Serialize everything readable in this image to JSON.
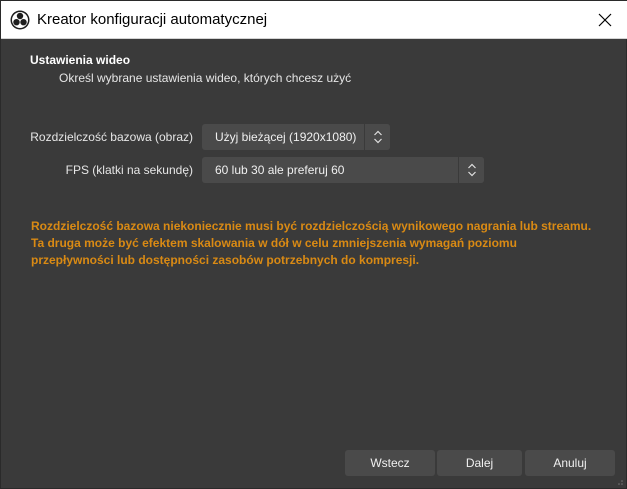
{
  "window": {
    "title": "Kreator konfiguracji automatycznej",
    "close_icon": "close-icon",
    "app_icon": "obs-logo-icon"
  },
  "section": {
    "title": "Ustawienia wideo",
    "description": "Określ wybrane ustawienia wideo, których chcesz użyć"
  },
  "form": {
    "resolution_label": "Rozdzielczość bazowa (obraz)",
    "resolution_value": "Użyj bieżącej (1920x1080)",
    "fps_label": "FPS (klatki na sekundę)",
    "fps_value": "60 lub 30 ale preferuj 60"
  },
  "warning": {
    "text": "Rozdzielczość bazowa niekoniecznie musi być rozdzielczością wynikowego nagrania lub streamu. Ta druga może być efektem skalowania w dół w celu zmniejszenia wymagań poziomu przepływności lub dostępności zasobów potrzebnych do kompresji.",
    "color": "#d98a14"
  },
  "buttons": {
    "back": "Wstecz",
    "next": "Dalej",
    "cancel": "Anuluj"
  },
  "colors": {
    "background": "#3a3a3a",
    "control": "#4a4a4a",
    "titlebar": "#ffffff"
  }
}
